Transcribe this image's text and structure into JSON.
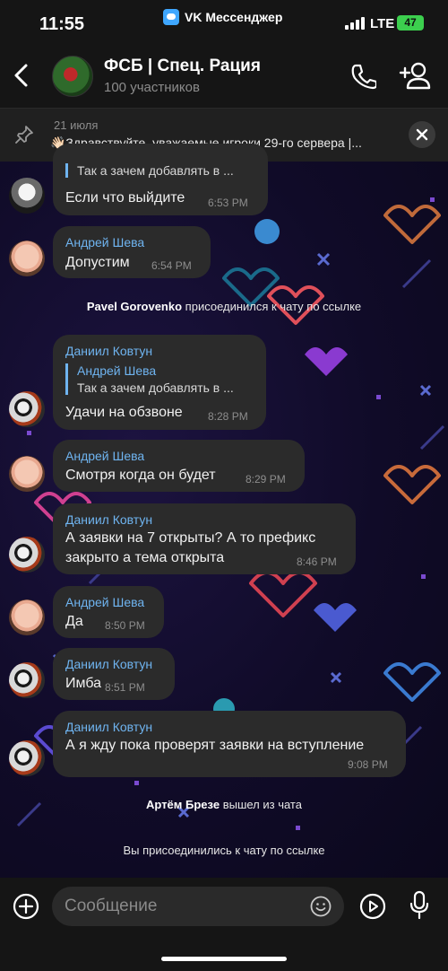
{
  "status_bar": {
    "time": "11:55",
    "app_name": "VK Мессенджер",
    "network": "LTE",
    "battery": "47"
  },
  "header": {
    "title": "ФСБ | Спец. Рация",
    "subtitle": "100 участников"
  },
  "pinned": {
    "date": "21 июля",
    "text": "👋🏻Здравствуйте, уважаемые игроки 29-го сервера |..."
  },
  "messages": [
    {
      "reply_text": "Так а зачем добавлять в ...",
      "text": "Если что выйдите",
      "time": "6:53 PM"
    },
    {
      "sender": "Андрей Шева",
      "text": "Допустим",
      "time": "6:54 PM"
    },
    {
      "sender": "Даниил Ковтун",
      "reply_name": "Андрей Шева",
      "reply_text": "Так а зачем добавлять в ...",
      "text": "Удачи на обзвоне",
      "time": "8:28 PM"
    },
    {
      "sender": "Андрей Шева",
      "text": "Смотря когда он будет",
      "time": "8:29 PM"
    },
    {
      "sender": "Даниил Ковтун",
      "text_line1": "А заявки на 7 открыты? А то префикс",
      "text_line2": "закрыто а тема открыта",
      "time": "8:46 PM"
    },
    {
      "sender": "Андрей Шева",
      "text": "Да",
      "time": "8:50 PM"
    },
    {
      "sender": "Даниил Ковтун",
      "text": "Имба",
      "time": "8:51 PM"
    },
    {
      "sender": "Даниил Ковтун",
      "text": "А я жду пока проверят заявки на вступление",
      "time": "9:08 PM"
    }
  ],
  "system": {
    "joined_name": "Pavel Gorovenko",
    "joined_text": "присоединился к чату по ссылке",
    "left_name": "Артём Брезе",
    "left_text": "вышел из чата",
    "you_joined": "Вы присоединились к чату по ссылке"
  },
  "input": {
    "placeholder": "Сообщение"
  },
  "colors": {
    "bubble": "#2b2b2b",
    "sender": "#6fb4f0",
    "accent": "#3fa7ff"
  }
}
